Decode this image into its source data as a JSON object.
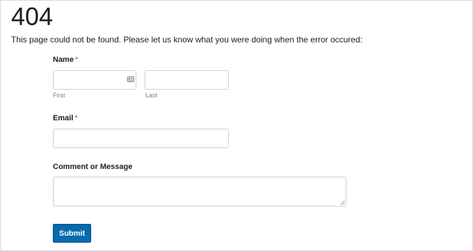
{
  "page": {
    "title": "404",
    "intro": "This page could not be found. Please let us know what you were doing when the error occured:"
  },
  "form": {
    "name": {
      "label": "Name",
      "required_mark": "*",
      "first_value": "",
      "last_value": "",
      "first_sublabel": "First",
      "last_sublabel": "Last",
      "first_icon": "contact-card-icon"
    },
    "email": {
      "label": "Email",
      "required_mark": "*",
      "value": ""
    },
    "comment": {
      "label": "Comment or Message",
      "value": ""
    },
    "submit_label": "Submit"
  },
  "colors": {
    "text": "#1d1d1d",
    "required": "#d63637",
    "button": "#066aab",
    "input_border": "#cfcfcf",
    "sublabel": "#7a7a7a"
  }
}
